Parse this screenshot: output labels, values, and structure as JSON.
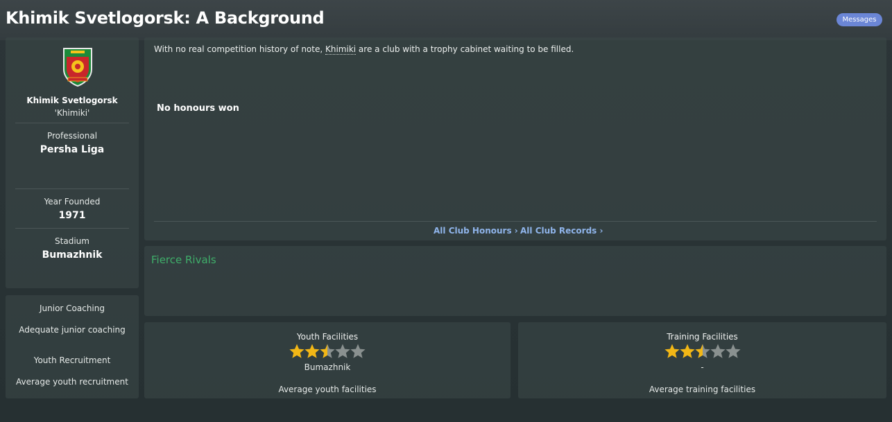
{
  "header": {
    "title": "Khimik Svetlogorsk: A Background",
    "messages_label": "Messages"
  },
  "club": {
    "name": "Khimik Svetlogorsk",
    "nickname": "'Khimiki'",
    "status": "Professional",
    "league": "Persha Liga",
    "founded_label": "Year Founded",
    "founded_value": "1971",
    "stadium_label": "Stadium",
    "stadium_value": "Bumazhnik"
  },
  "coaching": {
    "junior_label": "Junior Coaching",
    "junior_value": "Adequate junior coaching",
    "recruit_label": "Youth Recruitment",
    "recruit_value": "Average youth recruitment"
  },
  "history": {
    "intro_before": "With no real competition history of note, ",
    "intro_link": "Khimiki",
    "intro_after": " are a club with a trophy cabinet waiting to be filled.",
    "no_honours": "No honours won",
    "all_honours": "All Club Honours ›",
    "all_records": "All Club Records ›"
  },
  "rivals": {
    "title": "Fierce Rivals"
  },
  "facilities": {
    "youth": {
      "title": "Youth Facilities",
      "rating": 2.5,
      "max": 5,
      "sub": "Bumazhnik",
      "desc": "Average youth facilities"
    },
    "training": {
      "title": "Training Facilities",
      "rating": 2.5,
      "max": 5,
      "sub": "-",
      "desc": "Average training facilities"
    }
  },
  "colors": {
    "accent": "#6b86d6",
    "link": "#8fb4ea",
    "rivals": "#3fae6a",
    "star": "#f2b716",
    "star_empty": "#8a9190"
  }
}
